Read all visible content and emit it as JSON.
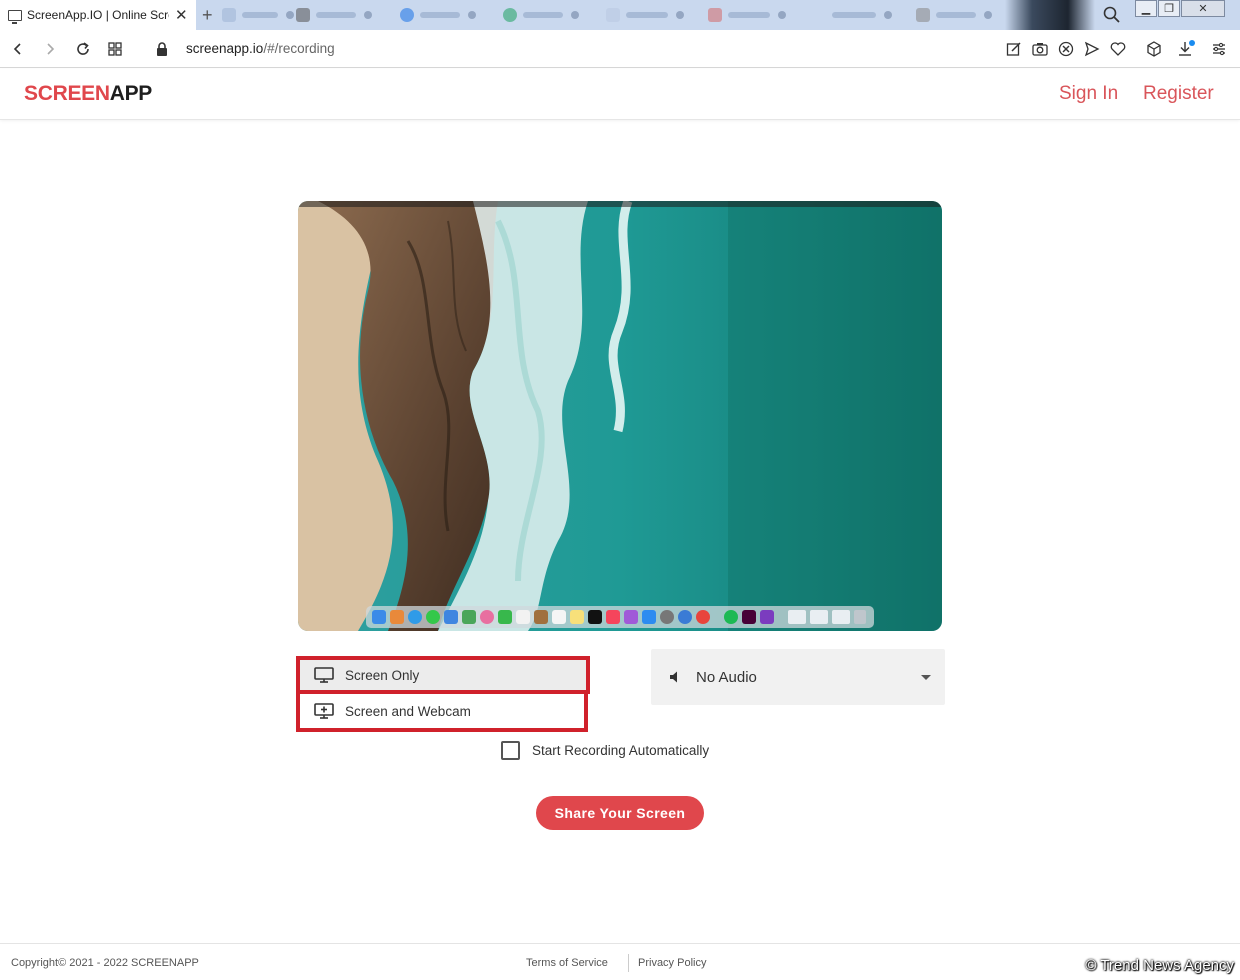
{
  "browser": {
    "active_tab_title": "ScreenApp.IO | Online Scre",
    "url_domain": "screenapp.io",
    "url_path": "/#/recording"
  },
  "header": {
    "logo_part1": "SCREEN",
    "logo_part2": "APP",
    "sign_in": "Sign In",
    "register": "Register"
  },
  "recording": {
    "source_options": [
      "Screen Only",
      "Screen and Webcam"
    ],
    "selected_source": "Screen Only",
    "audio_selected": "No Audio",
    "auto_start_label": "Start Recording Automatically",
    "auto_start_checked": false,
    "share_button": "Share Your Screen"
  },
  "footer": {
    "copyright": "Copyright©   2021 - 2022 SCREENAPP",
    "terms": "Terms of Service",
    "privacy": "Privacy Policy"
  },
  "watermark": "© Trend News Agency",
  "colors": {
    "brand_red": "#e0474c",
    "highlight_box": "#d0212b"
  }
}
